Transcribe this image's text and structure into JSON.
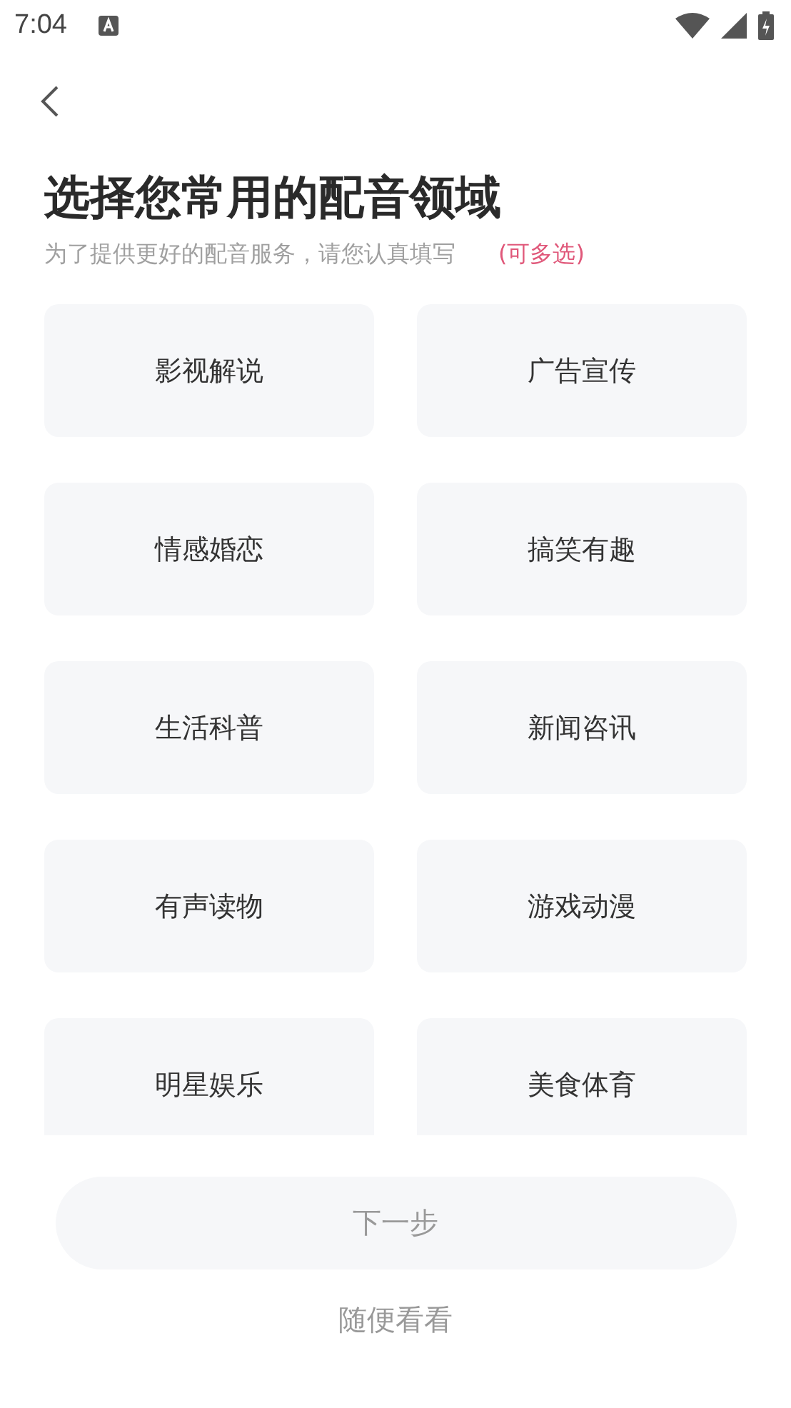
{
  "status_bar": {
    "time": "7:04"
  },
  "title": "选择您常用的配音领域",
  "subtitle": "为了提供更好的配音服务，请您认真填写",
  "hint": "(可多选)",
  "options": [
    {
      "label": "影视解说",
      "selected": false
    },
    {
      "label": "广告宣传",
      "selected": false
    },
    {
      "label": "情感婚恋",
      "selected": false
    },
    {
      "label": "搞笑有趣",
      "selected": false
    },
    {
      "label": "生活科普",
      "selected": false
    },
    {
      "label": "新闻咨讯",
      "selected": false
    },
    {
      "label": "有声读物",
      "selected": false
    },
    {
      "label": "游戏动漫",
      "selected": false
    },
    {
      "label": "明星娱乐",
      "selected": false
    },
    {
      "label": "美食体育",
      "selected": false
    }
  ],
  "next_button": {
    "label": "下一步",
    "disabled": true
  },
  "skip_link": "随便看看"
}
